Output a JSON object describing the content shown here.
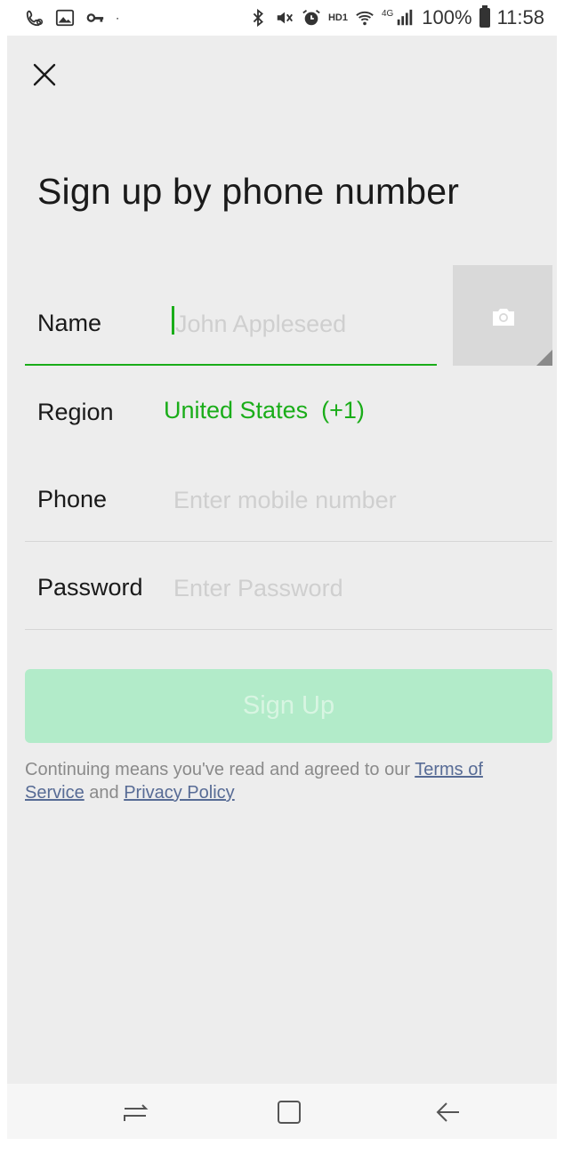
{
  "status_bar": {
    "left_icons": [
      "call-settings-icon",
      "gallery-icon",
      "vpn-key-icon",
      "dot-icon"
    ],
    "right_icons": [
      "bluetooth-icon",
      "mute-icon",
      "alarm-icon",
      "hd-icon",
      "wifi-icon",
      "signal-icon"
    ],
    "hd": "HD1",
    "network": "4G",
    "battery": "100%",
    "time": "11:58"
  },
  "header": {
    "close_icon": "close-icon",
    "title": "Sign up by phone number"
  },
  "form": {
    "name": {
      "label": "Name",
      "placeholder": "John Appleseed",
      "value": ""
    },
    "avatar": {
      "icon": "camera-icon"
    },
    "region": {
      "label": "Region",
      "value": "United States  (+1)"
    },
    "phone": {
      "label": "Phone",
      "placeholder": "Enter mobile number",
      "value": ""
    },
    "password": {
      "label": "Password",
      "placeholder": "Enter Password",
      "value": ""
    },
    "submit_label": "Sign Up"
  },
  "agreement": {
    "prefix": "Continuing means you've read and agreed to our ",
    "terms": "Terms of Service",
    "middle": " and ",
    "privacy": "Privacy Policy"
  },
  "nav": {
    "recent_icon": "recent-apps-icon",
    "home_icon": "home-icon",
    "back_icon": "back-icon"
  },
  "colors": {
    "accent": "#1aad19",
    "button_disabled": "#b2ebc9",
    "link": "#576b95",
    "background": "#ededed"
  }
}
